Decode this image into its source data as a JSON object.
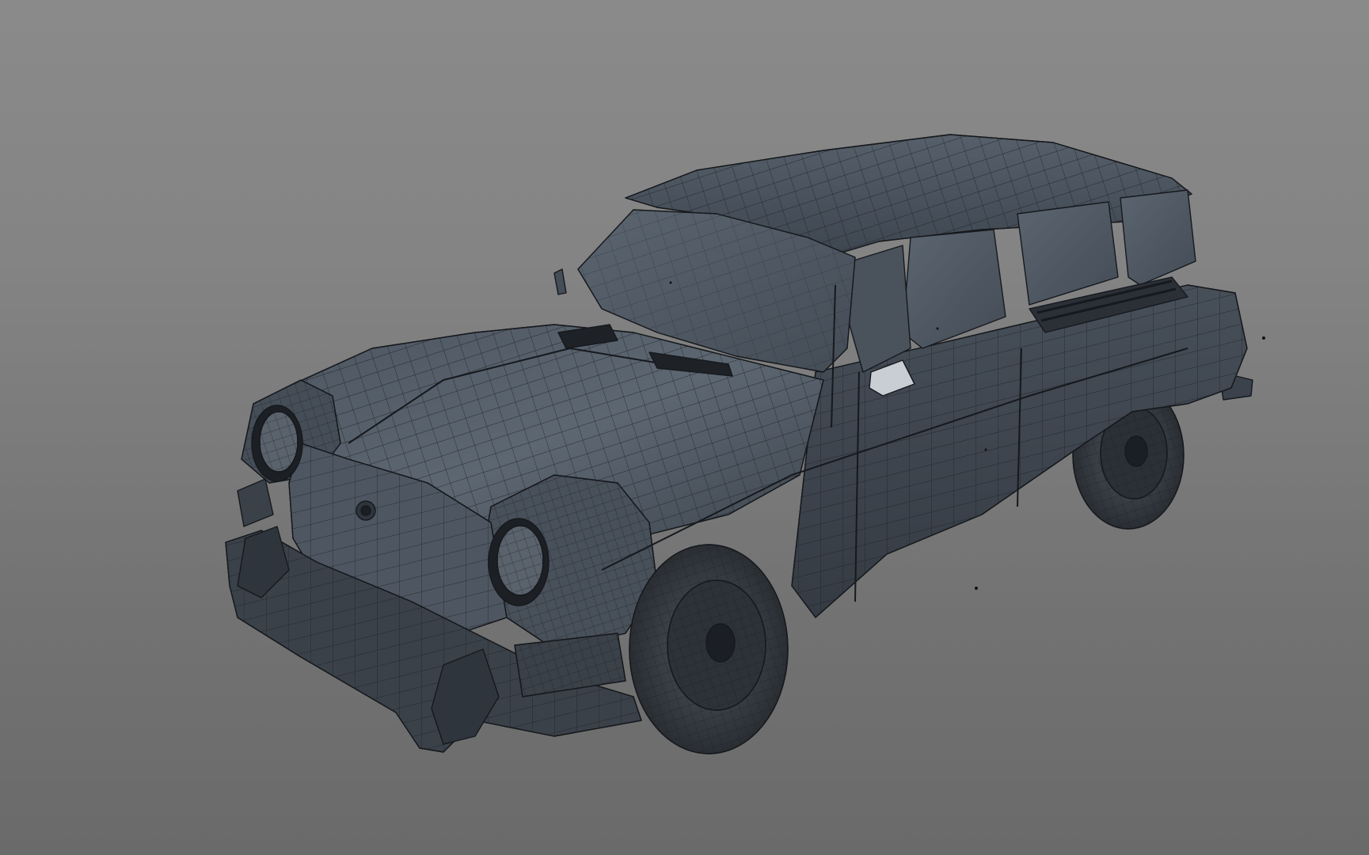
{
  "viewport": {
    "background_top": "#8a8a8a",
    "background_bottom": "#6a6a6a",
    "body_color": "#3f4650",
    "body_highlight": "#5a6470",
    "wire_color": "#1c1f24",
    "glass_color": "#4b535d",
    "tire_color": "#2a2e33"
  },
  "scene": {
    "object": "station-wagon-wireframe-model",
    "shading": "shaded-with-wireframe"
  }
}
